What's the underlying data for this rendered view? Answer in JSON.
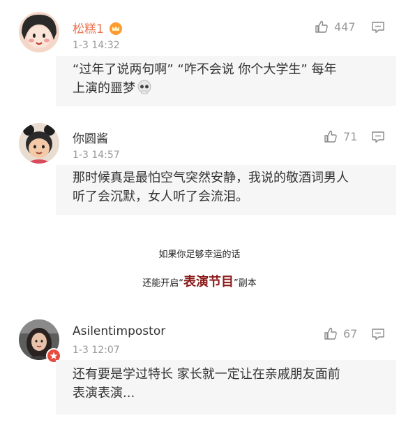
{
  "comments": [
    {
      "username": "松糕1",
      "time": "1-3 14:32",
      "like_count": "447",
      "text_line1": "“过年了说两句啊” “咋不会说 你个大学生” 每年",
      "text_line2": "上演的噩梦",
      "emoji": "skull-emoji"
    },
    {
      "username": "你圆酱",
      "time": "1-3 14:57",
      "like_count": "71",
      "text_line1": "那时候真是最怕空气突然安静，我说的敬酒词男人",
      "text_line2": "听了会沉默，女人听了会流泪。"
    },
    {
      "username": "Asilentimpostor",
      "time": "1-3 12:07",
      "like_count": "67",
      "text_line1": "还有要是学过特长 家长就一定让在亲戚朋友面前",
      "text_line2": "表演表演..."
    }
  ],
  "caption": {
    "line1": "如果你足够幸运的话",
    "line2_prefix": "还能开启“",
    "line2_highlight": "表演节目",
    "line2_suffix": "”副本"
  },
  "icons": {
    "like": "thumbs-up-icon",
    "reply": "comment-icon",
    "badge": "crown-badge-icon"
  },
  "colors": {
    "vip_name": "#eb7350",
    "muted": "#999999",
    "highlight": "#8b1a1a"
  }
}
